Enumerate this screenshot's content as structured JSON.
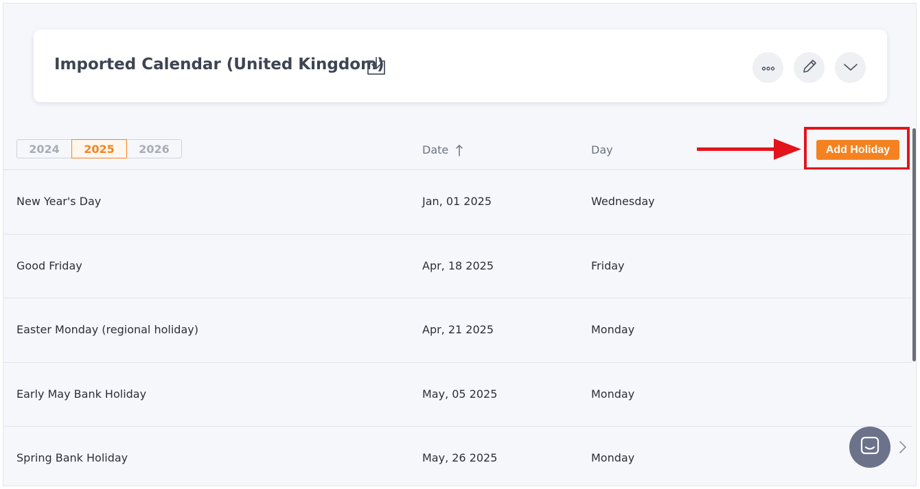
{
  "header": {
    "title": "Imported Calendar (United Kingdom)",
    "import_icon": "download-tray-icon",
    "actions": [
      {
        "name": "more-options",
        "icon": "ellipsis-icon"
      },
      {
        "name": "edit",
        "icon": "pencil-icon"
      },
      {
        "name": "collapse",
        "icon": "chevron-down-icon"
      }
    ]
  },
  "years": {
    "options": [
      "2024",
      "2025",
      "2026"
    ],
    "selected": "2025"
  },
  "columns": {
    "date": "Date",
    "date_sort_icon": "arrow-up-icon",
    "day": "Day"
  },
  "add_holiday_label": "Add Holiday",
  "holidays": [
    {
      "name": "New Year's Day",
      "date": "Jan, 01 2025",
      "day": "Wednesday"
    },
    {
      "name": "Good Friday",
      "date": "Apr, 18 2025",
      "day": "Friday"
    },
    {
      "name": "Easter Monday (regional holiday)",
      "date": "Apr, 21 2025",
      "day": "Monday"
    },
    {
      "name": "Early May Bank Holiday",
      "date": "May, 05 2025",
      "day": "Monday"
    },
    {
      "name": "Spring Bank Holiday",
      "date": "May, 26 2025",
      "day": "Monday"
    }
  ],
  "colors": {
    "accent": "#f58220",
    "annotation": "#e3141b",
    "chat": "#6b7289"
  }
}
